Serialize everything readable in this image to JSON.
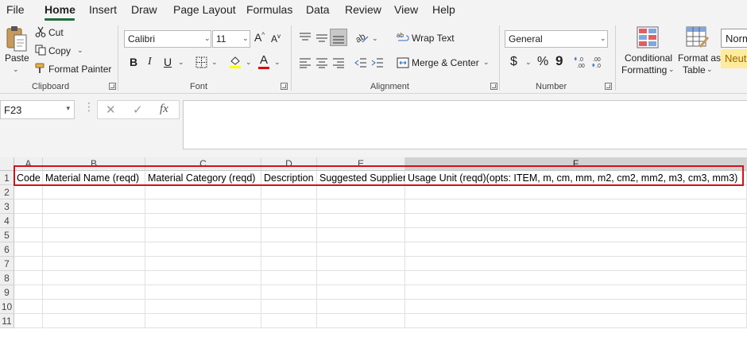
{
  "menu": {
    "tabs": [
      "File",
      "Home",
      "Insert",
      "Draw",
      "Page Layout",
      "Formulas",
      "Data",
      "Review",
      "View",
      "Help"
    ],
    "active": "Home"
  },
  "ribbon": {
    "clipboard": {
      "paste_label": "Paste",
      "cut_label": "Cut",
      "copy_label": "Copy",
      "format_painter_label": "Format Painter",
      "group_label": "Clipboard"
    },
    "font": {
      "font_name": "Calibri",
      "font_size": "11",
      "bold": "B",
      "italic": "I",
      "underline": "U",
      "group_label": "Font",
      "fill_color": "#ffff00",
      "font_color": "#e00000"
    },
    "alignment": {
      "wrap_text_label": "Wrap Text",
      "merge_center_label": "Merge & Center",
      "group_label": "Alignment"
    },
    "number": {
      "format": "General",
      "currency": "$",
      "percent": "%",
      "comma": "9",
      "group_label": "Number"
    },
    "styles": {
      "conditional_formatting_line1": "Conditional",
      "conditional_formatting_line2": "Formatting",
      "format_as_table_line1": "Format as",
      "format_as_table_line2": "Table",
      "normal_style": "Norm",
      "neutral_style": "Neut"
    }
  },
  "formula_bar": {
    "name_box": "F23",
    "fx": "fx",
    "content": ""
  },
  "sheet": {
    "columns": [
      "A",
      "B",
      "C",
      "D",
      "E",
      "F"
    ],
    "selected_column": "F",
    "rows": [
      "1",
      "2",
      "3",
      "4",
      "5",
      "6",
      "7",
      "8",
      "9",
      "10",
      "11"
    ],
    "row1": [
      "Code",
      "Material Name (reqd)",
      "Material Category (reqd)",
      "Description",
      "Suggested Supplier",
      "Usage Unit (reqd)(opts: ITEM, m, cm, mm, m2, cm2, mm2, m3, cm3, mm3)"
    ],
    "highlight_color": "#d0121b"
  }
}
